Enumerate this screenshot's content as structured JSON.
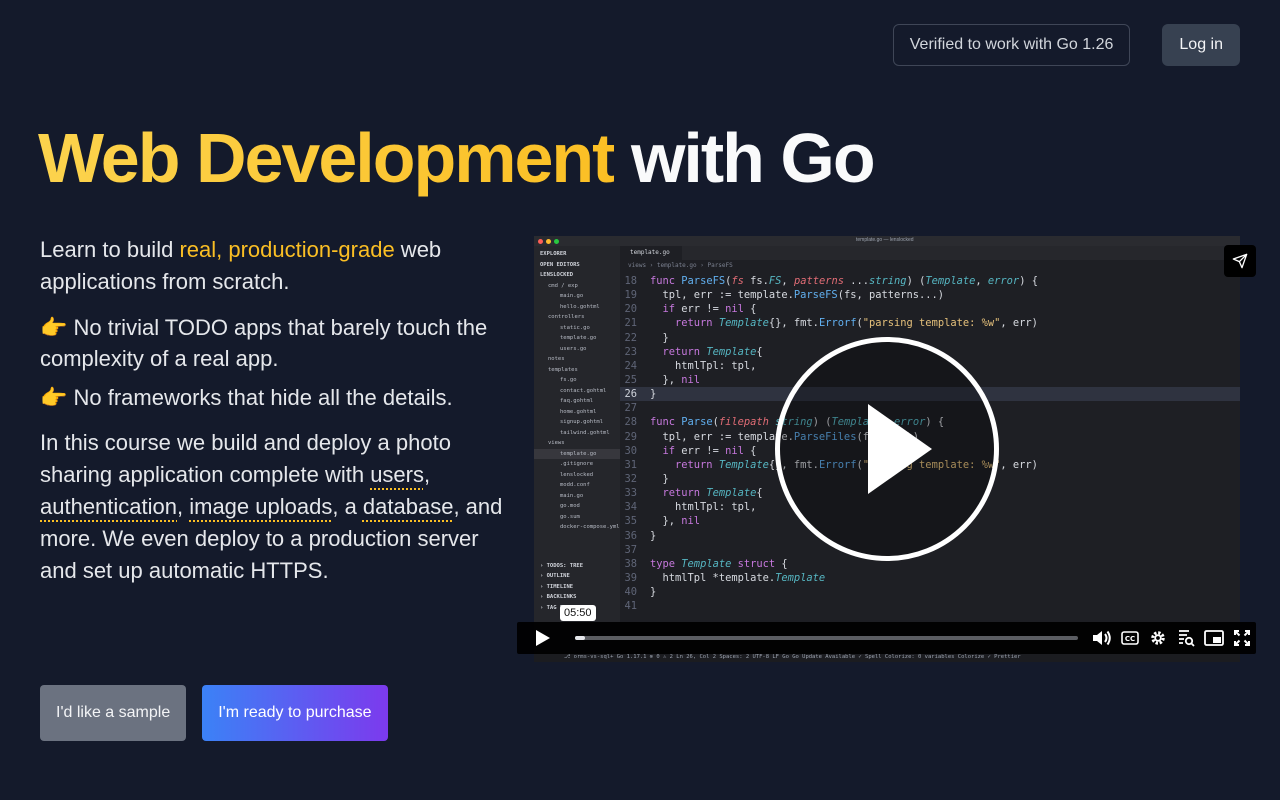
{
  "header": {
    "verified_badge": "Verified to work with Go 1.26",
    "login_label": "Log in"
  },
  "hero": {
    "title_accent": "Web Development",
    "title_rest": "with Go"
  },
  "copy": {
    "p1_a": "Learn to build ",
    "p1_hl": "real, production-grade",
    "p1_b": " web applications from scratch.",
    "bullet1": "👉 No trivial TODO apps that barely touch the complexity of a real app.",
    "bullet2": "👉 No frameworks that hide all the details.",
    "p3_a": "In this course we build and deploy a photo sharing application complete with ",
    "p3_users": "users",
    "p3_sep1": ", ",
    "p3_auth": "authentication",
    "p3_sep2": ", ",
    "p3_uploads": "image uploads",
    "p3_sep3": ", a ",
    "p3_db": "database",
    "p3_b": ", and more. We even deploy to a production server and set up automatic HTTPS."
  },
  "cta": {
    "sample_label": "I'd like a sample",
    "purchase_label": "I'm ready to purchase"
  },
  "video": {
    "window_title": "template.go — lenslocked",
    "tab_label": "template.go",
    "breadcrumb": "views › template.go › ParseFS",
    "explorer": [
      "EXPLORER",
      "OPEN EDITORS",
      "LENSLOCKED",
      "cmd / exp",
      "main.go",
      "hello.gohtml",
      "controllers",
      "static.go",
      "template.go",
      "users.go",
      "notes",
      "templates",
      "fs.go",
      "contact.gohtml",
      "faq.gohtml",
      "home.gohtml",
      "signup.gohtml",
      "tailwind.gohtml",
      "views",
      "template.go",
      ".gitignore",
      "lenslocked",
      "modd.conf",
      "main.go",
      "go.mod",
      "go.sum",
      "docker-compose.yml"
    ],
    "explorer_bottom": [
      "TODOS: TREE",
      "OUTLINE",
      "TIMELINE",
      "BACKLINKS",
      "TAG EXPLORER"
    ],
    "status_text": "⎇ orms-vs-sql+   Go 1.17.1   ⊗ 0 ⚠ 2          Ln 26, Col 2   Spaces: 2   UTF-8   LF   Go   Go Update Available   ✓ Spell   Colorize: 0 variables   Colorize   ✓ Prettier",
    "timestamp": "05:50",
    "progress": 0.02,
    "code_lines": [
      {
        "n": "18",
        "html": "<span class='k'>func</span> <span class='f'>ParseFS</span>(<span class='p'>fs</span> fs.<span class='t'>FS</span>, <span class='p'>patterns</span> ...<span class='t'>string</span>) (<span class='t'>Template</span>, <span class='t'>error</span>) {"
      },
      {
        "n": "19",
        "html": "  tpl, err := template.<span class='f'>ParseFS</span>(fs, patterns...)"
      },
      {
        "n": "20",
        "html": "  <span class='k'>if</span> err != <span class='k'>nil</span> {"
      },
      {
        "n": "21",
        "html": "    <span class='k'>return</span> <span class='t'>Template</span>{}, fmt.<span class='f'>Errorf</span>(<span class='s'>\"parsing template: %w\"</span>, err)"
      },
      {
        "n": "22",
        "html": "  }"
      },
      {
        "n": "23",
        "html": "  <span class='k'>return</span> <span class='t'>Template</span>{"
      },
      {
        "n": "24",
        "html": "    htmlTpl: tpl,"
      },
      {
        "n": "25",
        "html": "  }, <span class='k'>nil</span>"
      },
      {
        "n": "26",
        "html": "}",
        "cur": true
      },
      {
        "n": "27",
        "html": ""
      },
      {
        "n": "28",
        "html": "<span class='k'>func</span> <span class='f'>Parse</span>(<span class='p'>filepath</span> <span class='t'>string</span>) (<span class='t'>Template</span>, <span class='t'>error</span>) {"
      },
      {
        "n": "29",
        "html": "  tpl, err := template.<span class='f'>ParseFiles</span>(filepath)"
      },
      {
        "n": "30",
        "html": "  <span class='k'>if</span> err != <span class='k'>nil</span> {"
      },
      {
        "n": "31",
        "html": "    <span class='k'>return</span> <span class='t'>Template</span>{}, fmt.<span class='f'>Errorf</span>(<span class='s'>\"parsing template: %w\"</span>, err)"
      },
      {
        "n": "32",
        "html": "  }"
      },
      {
        "n": "33",
        "html": "  <span class='k'>return</span> <span class='t'>Template</span>{"
      },
      {
        "n": "34",
        "html": "    htmlTpl: tpl,"
      },
      {
        "n": "35",
        "html": "  }, <span class='k'>nil</span>"
      },
      {
        "n": "36",
        "html": "}"
      },
      {
        "n": "37",
        "html": ""
      },
      {
        "n": "38",
        "html": "<span class='k'>type</span> <span class='t'>Template</span> <span class='k'>struct</span> {"
      },
      {
        "n": "39",
        "html": "  htmlTpl *template.<span class='t'>Template</span>"
      },
      {
        "n": "40",
        "html": "}"
      },
      {
        "n": "41",
        "html": ""
      }
    ]
  },
  "colors": {
    "background": "#141a2b",
    "accent": "#fbbf24",
    "purchase_gradient_start": "#3b82f6",
    "purchase_gradient_end": "#7c3aed"
  }
}
